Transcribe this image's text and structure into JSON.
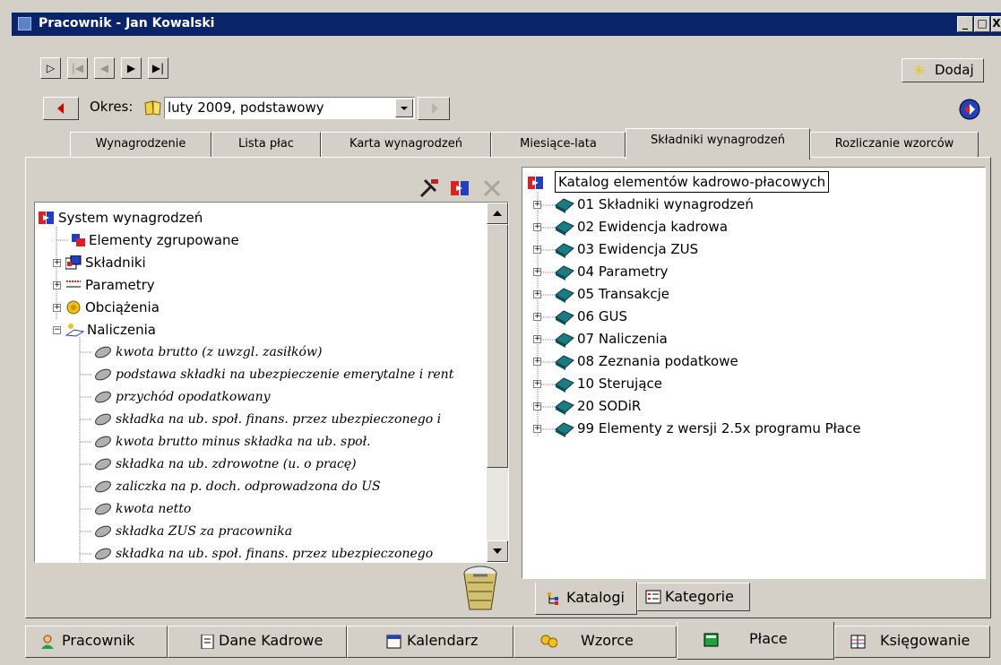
{
  "window": {
    "title": "Pracownik - Jan Kowalski",
    "min": "_",
    "max": "□",
    "close": "X"
  },
  "toolbar": {
    "add_label": "Dodaj",
    "add_icon": "sun-star-icon"
  },
  "period": {
    "label_prefix": "Okres: ",
    "value": "luty 2009, podstawowy"
  },
  "tabs": [
    {
      "label": "Wynagrodzenie"
    },
    {
      "label": "Lista płac"
    },
    {
      "label": "Karta wynagrodzeń"
    },
    {
      "label": "Miesiące-lata"
    },
    {
      "label": "Składniki wynagrodzeń"
    },
    {
      "label": "Rozliczanie wzorców"
    }
  ],
  "left_tree": {
    "root": "System wynagrodzeń",
    "groups": [
      "Elementy zgrupowane",
      "Składniki",
      "Parametry",
      "Obciążenia",
      "Naliczenia"
    ],
    "items": [
      "kwota brutto (z uwzgl. zasiłków)",
      "podstawa składki na ubezpieczenie emerytalne i rent",
      "przychód opodatkowany",
      "składka na ub. społ. finans. przez ubezpieczonego i",
      "kwota brutto minus składka na ub. społ.",
      "składka na ub. zdrowotne (u. o pracę)",
      "zaliczka na p. doch. odprowadzona do US",
      "kwota netto",
      "składka ZUS za pracownika",
      "składka na ub. społ. finans. przez ubezpieczonego"
    ]
  },
  "right_tree": {
    "root": "Katalog elementów kadrowo-płacowych",
    "items": [
      "01 Składniki wynagrodzeń",
      "02 Ewidencja kadrowa",
      "03 Ewidencja ZUS",
      "04 Parametry",
      "05 Transakcje",
      "06 GUS",
      "07 Naliczenia",
      "08 Zeznania podatkowe",
      "10 Sterujące",
      "20 SODiR",
      "99 Elementy z wersji 2.5x programu Płace"
    ]
  },
  "inner_tabs": [
    {
      "label": "Katalogi"
    },
    {
      "label": "Kategorie"
    }
  ],
  "bottom_tabs": [
    {
      "label": "Pracownik"
    },
    {
      "label": "Dane Kadrowe"
    },
    {
      "label": "Kalendarz"
    },
    {
      "label": "Wzorce"
    },
    {
      "label": "Płace"
    },
    {
      "label": "Księgowanie"
    }
  ],
  "colors": {
    "titlebar": "#0a246a",
    "face": "#d4d0c8",
    "book": "#1e7a82"
  }
}
